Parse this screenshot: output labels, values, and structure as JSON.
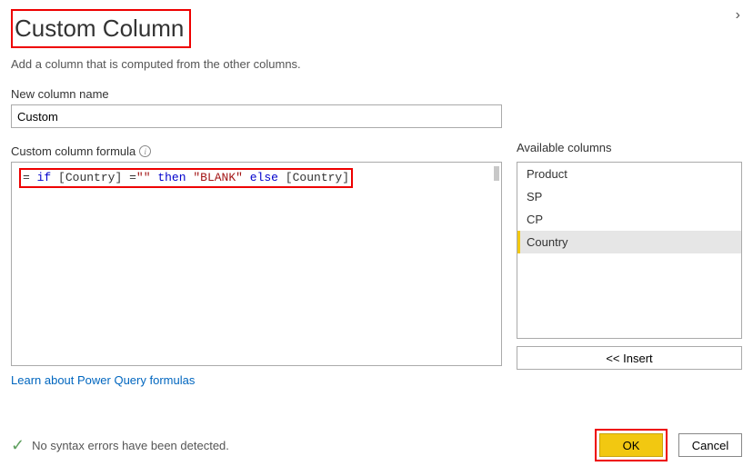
{
  "header": {
    "title": "Custom Column",
    "subtitle": "Add a column that is computed from the other columns."
  },
  "name_field": {
    "label": "New column name",
    "value": "Custom"
  },
  "formula": {
    "label": "Custom column formula",
    "eq": "=",
    "kw_if": "if",
    "col_ref1": "[Country]",
    "eq2": "=",
    "str_empty": "\"\"",
    "kw_then": "then",
    "str_blank": "\"BLANK\"",
    "kw_else": "else",
    "col_ref2_open": "[",
    "col_ref2_text": "Country",
    "col_ref2_close": "]"
  },
  "available": {
    "label": "Available columns",
    "items": [
      "Product",
      "SP",
      "CP",
      "Country"
    ],
    "selected_index": 3,
    "insert_label": "<< Insert"
  },
  "link": {
    "label": "Learn about Power Query formulas"
  },
  "status": {
    "message": "No syntax errors have been detected."
  },
  "buttons": {
    "ok": "OK",
    "cancel": "Cancel"
  }
}
